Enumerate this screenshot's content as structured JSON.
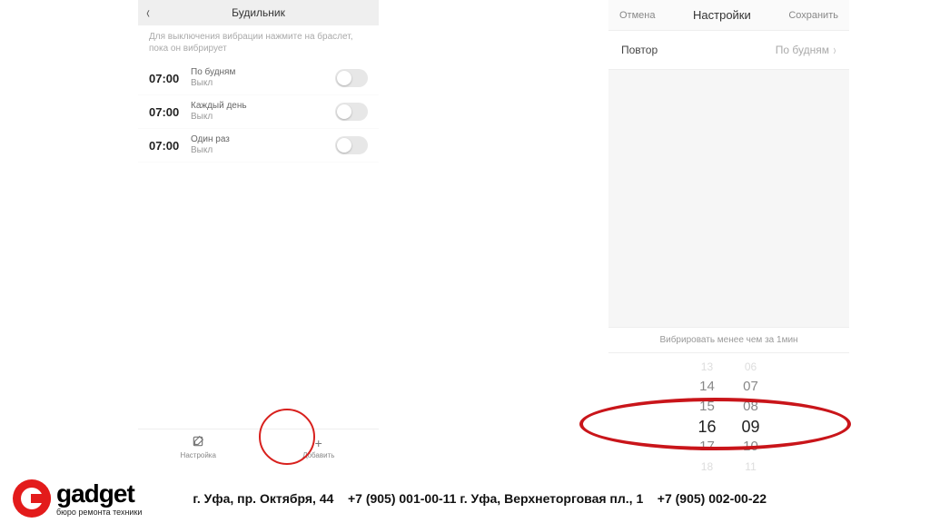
{
  "left": {
    "title": "Будильник",
    "hint": "Для выключения вибрации нажмите на браслет, пока он вибрирует",
    "alarms": [
      {
        "time": "07:00",
        "repeat": "По будням",
        "status": "Выкл"
      },
      {
        "time": "07:00",
        "repeat": "Каждый день",
        "status": "Выкл"
      },
      {
        "time": "07:00",
        "repeat": "Один раз",
        "status": "Выкл"
      }
    ],
    "bottom": {
      "edit_label": "Настройка",
      "add_label": "Добавить"
    }
  },
  "right": {
    "cancel": "Отмена",
    "title": "Настройки",
    "save": "Сохранить",
    "repeat_label": "Повтор",
    "repeat_value": "По будням",
    "vibrate_hint": "Вибрировать менее чем за 1мин",
    "picker": {
      "hours": [
        "13",
        "14",
        "15",
        "16",
        "17",
        "18"
      ],
      "minutes": [
        "06",
        "07",
        "08",
        "09",
        "10",
        "11"
      ],
      "selected_hour": "16",
      "selected_minute": "09"
    }
  },
  "footer": {
    "brand": "gadget",
    "tagline": "бюро ремонта техники",
    "addr1": "г. Уфа, пр. Октября, 44",
    "phone1": "+7 (905) 001-00-11",
    "addr2": "г. Уфа, Верхнеторговая пл., 1",
    "phone2": "+7 (905) 002-00-22"
  }
}
